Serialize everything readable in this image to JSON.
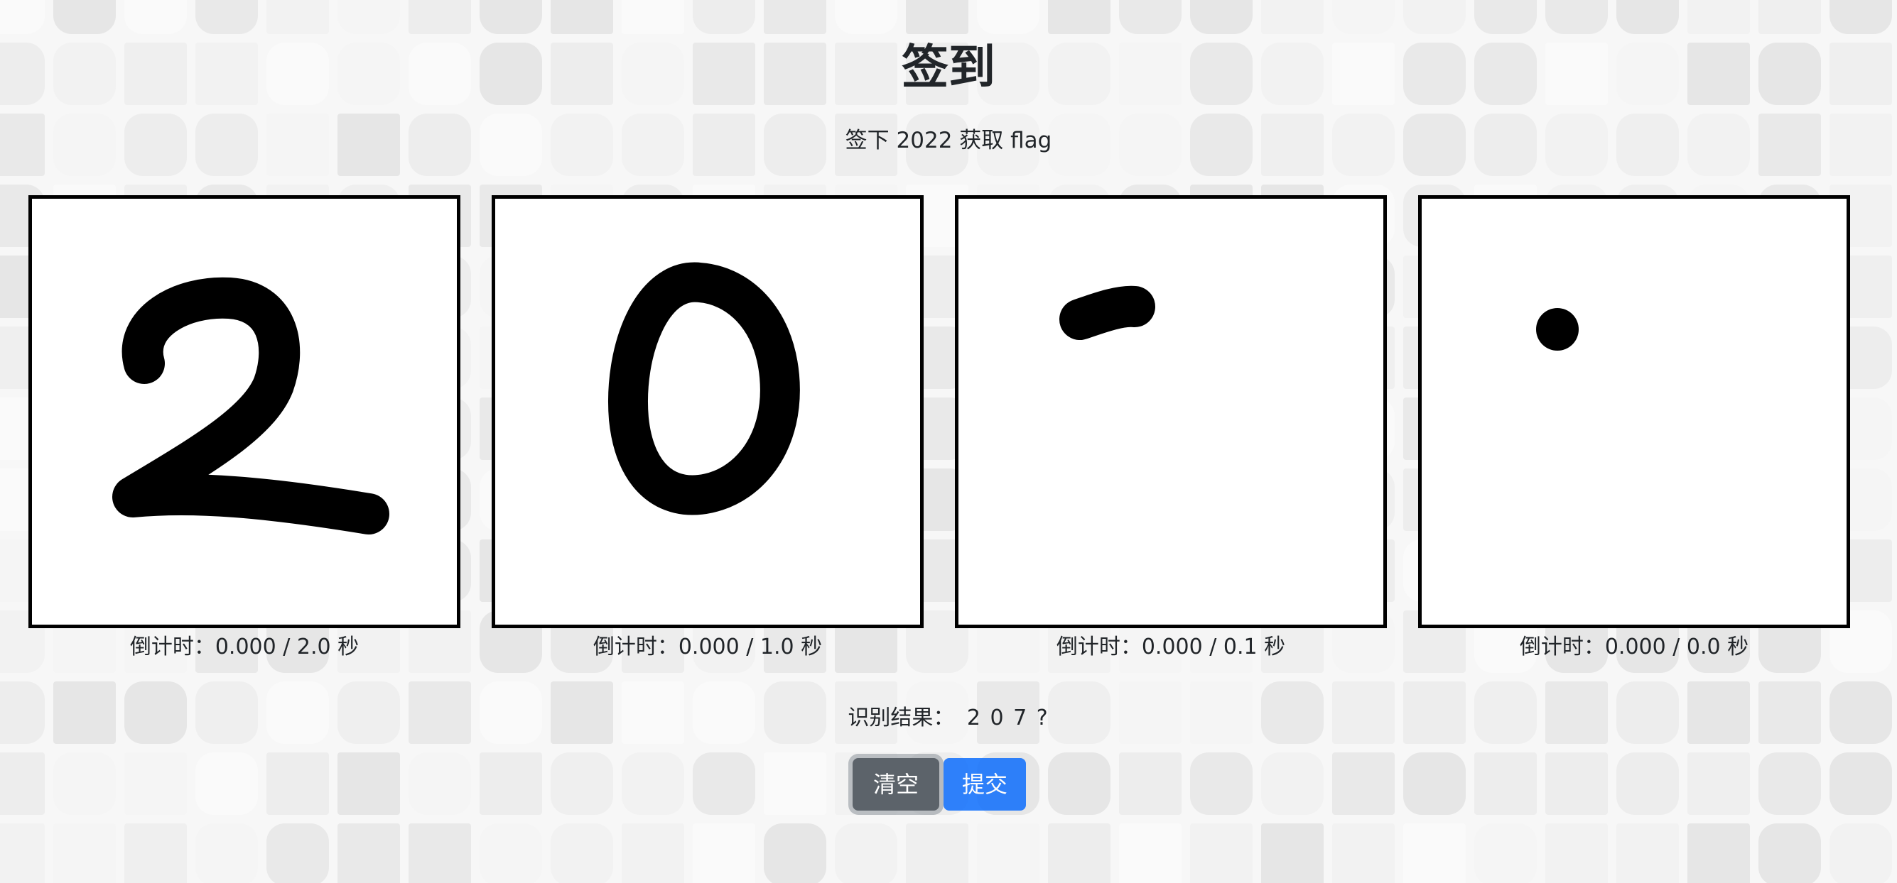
{
  "title": "签到",
  "subtitle": "签下 2022 获取 flag",
  "canvases": [
    {
      "countdown": "倒计时：0.000 / 2.0 秒"
    },
    {
      "countdown": "倒计时：0.000 / 1.0 秒"
    },
    {
      "countdown": "倒计时：0.000 / 0.1 秒"
    },
    {
      "countdown": "倒计时：0.000 / 0.0 秒"
    }
  ],
  "result": {
    "label": "识别结果：",
    "value": "2 0 7 ?"
  },
  "buttons": {
    "clear_label": "清空",
    "submit_label": "提交"
  },
  "colors": {
    "clear_button": "#5c636a",
    "submit_button": "#0d6efd",
    "ink": "#000000"
  }
}
